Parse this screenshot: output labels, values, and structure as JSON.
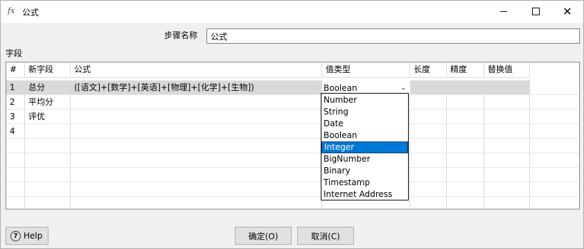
{
  "window": {
    "icon": "fx",
    "title": "公式",
    "buttons": [
      "minimize",
      "maximize",
      "close"
    ]
  },
  "step": {
    "label": "步骤名称",
    "value": "公式"
  },
  "fields_label": "字段",
  "table": {
    "sort_marker": "^",
    "columns": [
      "#",
      "新字段",
      "公式",
      "值类型",
      "长度",
      "精度",
      "替换值"
    ],
    "rows": [
      {
        "num": "1",
        "field": "总分",
        "formula": "([语文]+[数学]+[英语]+[物理]+[化学]+[生物])",
        "type": "Boolean",
        "length": "",
        "precision": "",
        "replace": ""
      },
      {
        "num": "2",
        "field": "平均分",
        "formula": "",
        "type": "",
        "length": "",
        "precision": "",
        "replace": ""
      },
      {
        "num": "3",
        "field": "评优",
        "formula": "",
        "type": "",
        "length": "",
        "precision": "",
        "replace": ""
      },
      {
        "num": "4",
        "field": "",
        "formula": "",
        "type": "",
        "length": "",
        "precision": "",
        "replace": ""
      }
    ],
    "selected_row": 0
  },
  "type_dropdown": {
    "options": [
      "Number",
      "String",
      "Date",
      "Boolean",
      "Integer",
      "BigNumber",
      "Binary",
      "Timestamp",
      "Internet Address"
    ],
    "highlighted": "Integer"
  },
  "buttons": {
    "help": "Help",
    "ok": "确定(O)",
    "cancel": "取消(C)"
  }
}
